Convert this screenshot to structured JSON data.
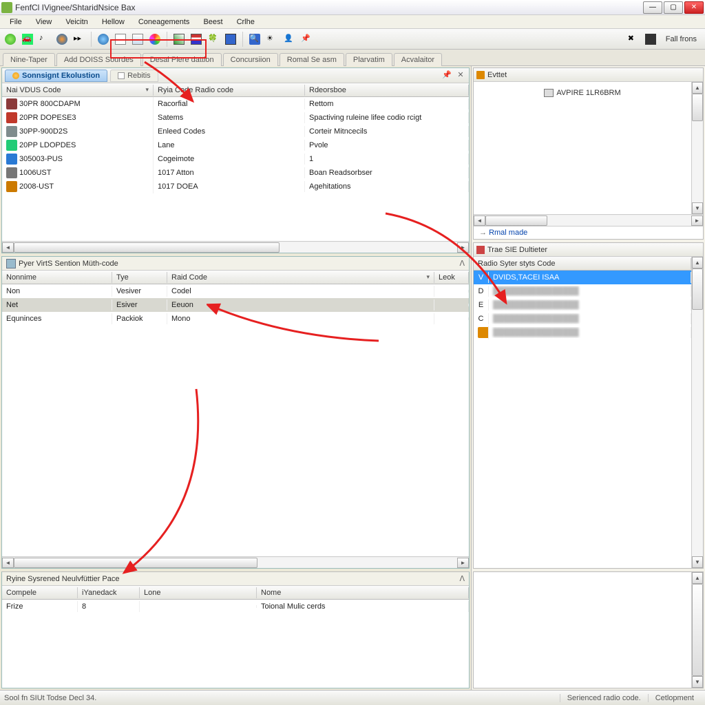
{
  "window": {
    "title": "FenfCl IVignee/ShtaridNsice Bax"
  },
  "menu": [
    "File",
    "View",
    "Veicitn",
    "Hellow",
    "Coneagements",
    "Beest",
    "Crlhe"
  ],
  "toolbar_right_text": "Fall frons",
  "tabs": [
    "Nine-Taper",
    "Add DOISS Sourdes",
    "Desal Plere dattion",
    "Concursiion",
    "Romal Se asm",
    "Plarvatim",
    "Acvalaitor"
  ],
  "top_panel": {
    "tab_active": "Sonnsignt Ekolustion",
    "tab_inactive": "Rebitis",
    "columns": [
      "Nai VDUS Code",
      "Ryia Code Radio code",
      "Rdeorsboe"
    ],
    "rows": [
      {
        "ico": "#8c3b3b",
        "c0": "30PR 800CDAPM",
        "c1": "Racorfial",
        "c2": "Rettom"
      },
      {
        "ico": "#c0392b",
        "c0": "20PR DOPESE3",
        "c1": "Satems",
        "c2": "Spactiving ruleine lifee codio rcigt"
      },
      {
        "ico": "#7f8c8d",
        "c0": "30PP-900D2S",
        "c1": "Enleed Codes",
        "c2": "Corteir Mitncecils"
      },
      {
        "ico": "#2c7",
        "c0": "20PP LDOPDES",
        "c1": "Lane",
        "c2": "Pvole"
      },
      {
        "ico": "#2a7ad4",
        "c0": "305003-PUS",
        "c1": "Cogeimote",
        "c2": "1"
      },
      {
        "ico": "#777",
        "c0": "1006UST",
        "c1": "1017 Atton",
        "c2": "Boan Readsorbser"
      },
      {
        "ico": "#cc7a00",
        "c0": "2008-UST",
        "c1": "1017 DOEA",
        "c2": "Agehitations"
      }
    ]
  },
  "mid_panel": {
    "title": "Pyer VirtS Sention Müth-code",
    "columns": [
      "Nonnime",
      "Tye",
      "Raid Code",
      "Leok"
    ],
    "rows": [
      {
        "c0": "Non",
        "c1": "Vesiver",
        "c2": "Codel"
      },
      {
        "c0": "Net",
        "c1": "Esiver",
        "c2": "Eeuon",
        "sel": true
      },
      {
        "c0": "Equninces",
        "c1": "Packiok",
        "c2": "Mono"
      }
    ]
  },
  "right_top": {
    "title": "Evttet",
    "content": "AVPIRE 1LR6BRM",
    "link": "Rmal made"
  },
  "right_mid": {
    "title": "Trae SIE Dultieter",
    "header": "Radio Syter styts Code",
    "items": [
      {
        "t": "V",
        "label": "DVIDS,TACEI ISAA",
        "sel": true
      },
      {
        "t": "D",
        "label": "",
        "blur": true
      },
      {
        "t": "E",
        "label": "",
        "blur": true
      },
      {
        "t": "C",
        "label": "",
        "blur": true
      },
      {
        "t": "",
        "label": "",
        "blur": true,
        "ico": true
      }
    ]
  },
  "bottom_panel": {
    "title": "Ryine Sysrened Neulvfüttier Pace",
    "columns": [
      "Compele",
      "iYanedack",
      "Lone",
      "Nome"
    ],
    "rows": [
      {
        "c0": "Frize",
        "c1": "8",
        "c2": "",
        "c3": "Toional Mulic cerds"
      }
    ]
  },
  "status": {
    "left": "Sool fn SIUt Todse Decl 34.",
    "mid": "Serienced radio code.",
    "right": "Cetlopment"
  }
}
